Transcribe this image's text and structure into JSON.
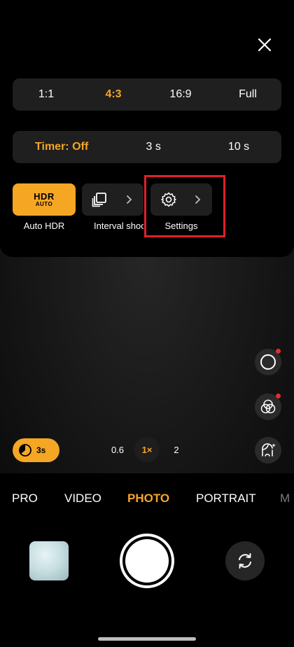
{
  "aspect_ratio": {
    "options": [
      "1:1",
      "4:3",
      "16:9",
      "Full"
    ],
    "selected": "4:3"
  },
  "timer": {
    "options": [
      "Timer: Off",
      "3 s",
      "10 s"
    ],
    "selected": "Timer: Off"
  },
  "tools": {
    "hdr": {
      "badge_top": "HDR",
      "badge_bottom": "AUTO",
      "label": "Auto HDR"
    },
    "interval": {
      "label": "Interval shooting",
      "icon": "stack-icon"
    },
    "settings": {
      "label": "Settings",
      "icon": "gear-icon"
    }
  },
  "quick": {
    "timer_chip": "3s"
  },
  "zoom": {
    "levels": [
      "0.6",
      "1×",
      "2"
    ],
    "selected": "1×"
  },
  "modes": {
    "items": [
      "PRO",
      "VIDEO",
      "PHOTO",
      "PORTRAIT",
      "M"
    ],
    "selected": "PHOTO"
  },
  "colors": {
    "accent": "#f5a623",
    "highlight": "#e0202a",
    "notification": "#e0302a"
  }
}
